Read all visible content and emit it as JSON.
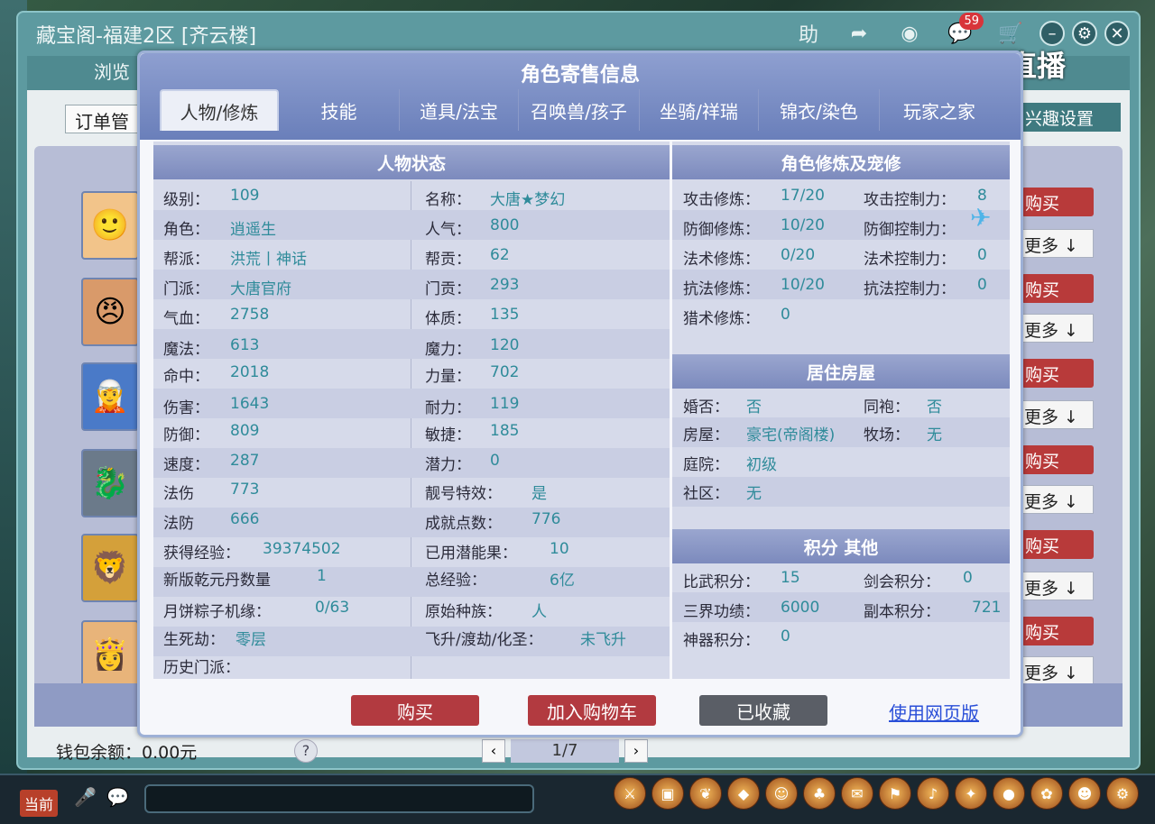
{
  "window": {
    "title": "藏宝阁-福建2区 [齐云楼]",
    "badge_count": "59"
  },
  "watermark": "CC直播",
  "nav": {
    "browse": "浏览",
    "order_btn": "订单管",
    "interest_btn": "兴趣设置"
  },
  "side": {
    "buy": "购买",
    "more": "更多 ↓"
  },
  "wallet": "钱包余额：0.00元",
  "pager": {
    "current": "1/7"
  },
  "bottom": {
    "current_btn": "当前"
  },
  "modal": {
    "title": "角色寄售信息",
    "tabs": [
      "人物/修炼",
      "技能",
      "道具/法宝",
      "召唤兽/孩子",
      "坐骑/祥瑞",
      "锦衣/染色",
      "玩家之家"
    ],
    "sections": {
      "status": "人物状态",
      "practice": "角色修炼及宠修",
      "house": "居住房屋",
      "points": "积分 其他"
    },
    "status_left": [
      {
        "label": "级别：",
        "value": "109"
      },
      {
        "label": "角色：",
        "value": "逍遥生"
      },
      {
        "label": "帮派：",
        "value": "洪荒丨神话"
      },
      {
        "label": "门派：",
        "value": "大唐官府"
      },
      {
        "label": "气血：",
        "value": "2758"
      },
      {
        "label": "魔法：",
        "value": "613"
      },
      {
        "label": "命中：",
        "value": "2018"
      },
      {
        "label": "伤害：",
        "value": "1643"
      },
      {
        "label": "防御：",
        "value": "809"
      },
      {
        "label": "速度：",
        "value": "287"
      },
      {
        "label": "法伤",
        "value": "773"
      },
      {
        "label": "法防",
        "value": "666"
      },
      {
        "label": "获得经验：",
        "value": "39374502"
      },
      {
        "label": "新版乾元丹数量",
        "value": "1"
      },
      {
        "label": "月饼粽子机缘：",
        "value": "0/63"
      },
      {
        "label": "生死劫：",
        "value": "零层"
      },
      {
        "label": "历史门派：",
        "value": ""
      }
    ],
    "status_right": [
      {
        "label": "名称：",
        "value": "大唐★梦幻"
      },
      {
        "label": "人气：",
        "value": "800"
      },
      {
        "label": "帮贡：",
        "value": "62"
      },
      {
        "label": "门贡：",
        "value": "293"
      },
      {
        "label": "体质：",
        "value": "135"
      },
      {
        "label": "魔力：",
        "value": "120"
      },
      {
        "label": "力量：",
        "value": "702"
      },
      {
        "label": "耐力：",
        "value": "119"
      },
      {
        "label": "敏捷：",
        "value": "185"
      },
      {
        "label": "潜力：",
        "value": "0"
      },
      {
        "label": "靓号特效：",
        "value": "是"
      },
      {
        "label": "成就点数：",
        "value": "776"
      },
      {
        "label": "已用潜能果：",
        "value": "10"
      },
      {
        "label": "总经验：",
        "value": "6亿"
      },
      {
        "label": "原始种族：",
        "value": "人"
      },
      {
        "label": "飞升/渡劫/化圣：",
        "value": "未飞升"
      }
    ],
    "practice_left": [
      {
        "label": "攻击修炼：",
        "value": "17/20"
      },
      {
        "label": "防御修炼：",
        "value": "10/20"
      },
      {
        "label": "法术修炼：",
        "value": "0/20"
      },
      {
        "label": "抗法修炼：",
        "value": "10/20"
      },
      {
        "label": "猎术修炼：",
        "value": "0"
      }
    ],
    "practice_right": [
      {
        "label": "攻击控制力：",
        "value": "8"
      },
      {
        "label": "防御控制力：",
        "value": ""
      },
      {
        "label": "法术控制力：",
        "value": "0"
      },
      {
        "label": "抗法控制力：",
        "value": "0"
      }
    ],
    "house": [
      {
        "label": "婚否：",
        "value": "否"
      },
      {
        "label": "同袍：",
        "value": "否"
      },
      {
        "label": "房屋：",
        "value": "豪宅(帝阁楼)"
      },
      {
        "label": "牧场：",
        "value": "无"
      },
      {
        "label": "庭院：",
        "value": "初级"
      },
      {
        "label": "社区：",
        "value": "无"
      }
    ],
    "points": [
      {
        "label": "比武积分：",
        "value": "15"
      },
      {
        "label": "剑会积分：",
        "value": "0"
      },
      {
        "label": "三界功绩：",
        "value": "6000"
      },
      {
        "label": "副本积分：",
        "value": "721"
      },
      {
        "label": "神器积分：",
        "value": "0"
      }
    ],
    "buttons": {
      "buy": "购买",
      "cart": "加入购物车",
      "saved": "已收藏",
      "web": "使用网页版"
    }
  }
}
